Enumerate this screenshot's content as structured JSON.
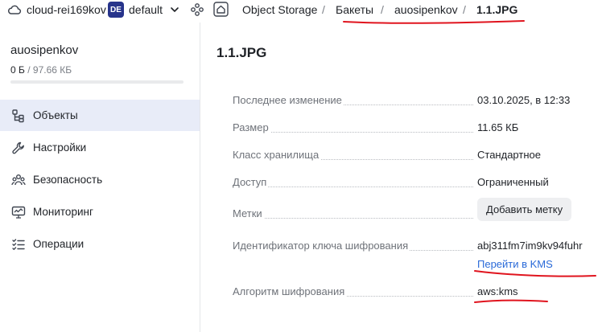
{
  "topbar": {
    "cloud_label": "cloud-rei169kov",
    "folder_badge": "DE",
    "folder_label": "default",
    "breadcrumbs": [
      {
        "label": "Object Storage"
      },
      {
        "label": "Бакеты"
      },
      {
        "label": "auosipenkov"
      },
      {
        "label": "1.1.JPG"
      }
    ],
    "separator": "/"
  },
  "sidebar": {
    "bucket_name": "auosipenkov",
    "usage_used": "0 Б",
    "usage_total": " / 97.66 КБ",
    "usage_fraction": 0,
    "items": [
      {
        "label": "Объекты",
        "icon": "objects-icon",
        "active": true
      },
      {
        "label": "Настройки",
        "icon": "wrench-icon",
        "active": false
      },
      {
        "label": "Безопасность",
        "icon": "users-icon",
        "active": false
      },
      {
        "label": "Мониторинг",
        "icon": "monitor-icon",
        "active": false
      },
      {
        "label": "Операции",
        "icon": "checklist-icon",
        "active": false
      }
    ]
  },
  "main": {
    "title": "1.1.JPG",
    "props": {
      "modified_label": "Последнее изменение",
      "modified_value": "03.10.2025, в 12:33",
      "size_label": "Размер",
      "size_value": "11.65 КБ",
      "class_label": "Класс хранилища",
      "class_value": "Стандартное",
      "access_label": "Доступ",
      "access_value": "Ограниченный",
      "tags_label": "Метки",
      "add_tag_button": "Добавить метку",
      "kms_key_label": "Идентификатор ключа шифрования",
      "kms_key_value": "abj311fm7im9kv94fuhr",
      "kms_link": "Перейти в KMS",
      "algo_label": "Алгоритм шифрования",
      "algo_value": "aws:kms"
    }
  },
  "colors": {
    "accent": "#2a6ad8",
    "badge": "#27348b",
    "active_bg": "#e8ecf8",
    "annotation_red": "#e0141e"
  }
}
